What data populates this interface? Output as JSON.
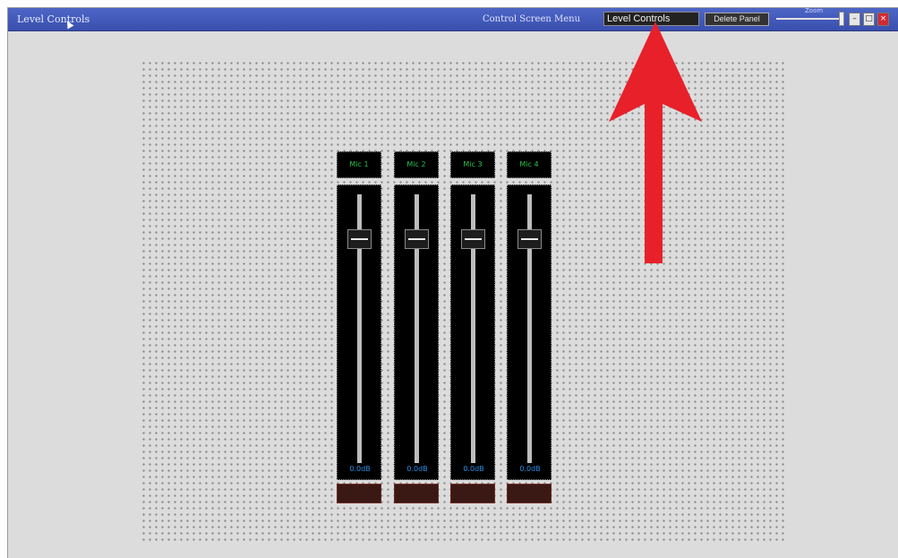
{
  "window": {
    "title": "Level Controls",
    "menu_label": "Control Screen Menu",
    "selected_screen": "Level Controls",
    "delete_button": "Delete Panel",
    "zoom_label": "Zoom",
    "zoom_level": 0.93,
    "buttons": {
      "minimize": "–",
      "maximize": "□",
      "close": "×"
    }
  },
  "channels": [
    {
      "name": "Mic 1",
      "level_db": "0.0dB",
      "fader_position": 0.85
    },
    {
      "name": "Mic 2",
      "level_db": "0.0dB",
      "fader_position": 0.85
    },
    {
      "name": "Mic 3",
      "level_db": "0.0dB",
      "fader_position": 0.85
    },
    {
      "name": "Mic 4",
      "level_db": "0.0dB",
      "fader_position": 0.85
    }
  ],
  "colors": {
    "titlebar": "#3a4fae",
    "label_text": "#26c24c",
    "db_text": "#2a8fe6",
    "mute": "#3a1814",
    "annotation_arrow": "#e8202a"
  }
}
